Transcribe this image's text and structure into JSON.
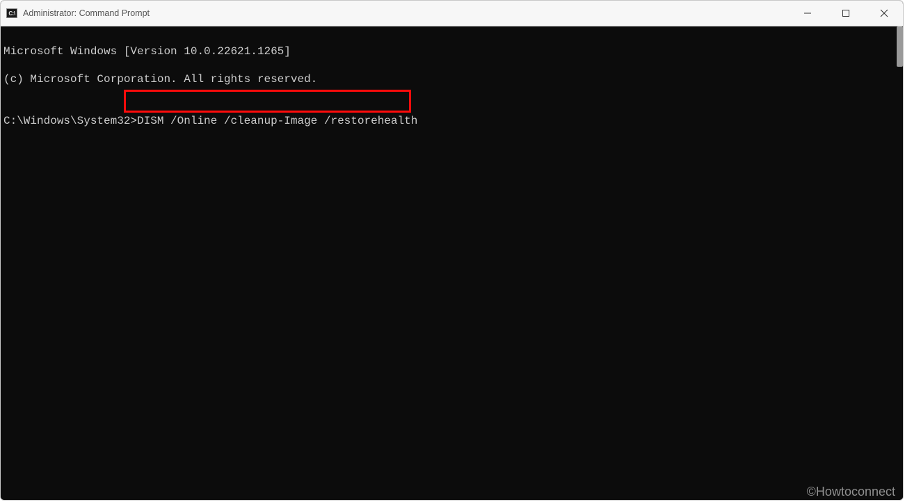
{
  "titlebar": {
    "icon_label": "C:\\",
    "title": "Administrator: Command Prompt"
  },
  "window_controls": {
    "minimize_name": "minimize",
    "maximize_name": "maximize",
    "close_name": "close"
  },
  "terminal": {
    "line1": "Microsoft Windows [Version 10.0.22621.1265]",
    "line2": "(c) Microsoft Corporation. All rights reserved.",
    "blank": "",
    "prompt_path": "C:\\Windows\\System32>",
    "command": "DISM /Online /cleanup-Image /restorehealth"
  },
  "watermark": "©Howtoconnect"
}
